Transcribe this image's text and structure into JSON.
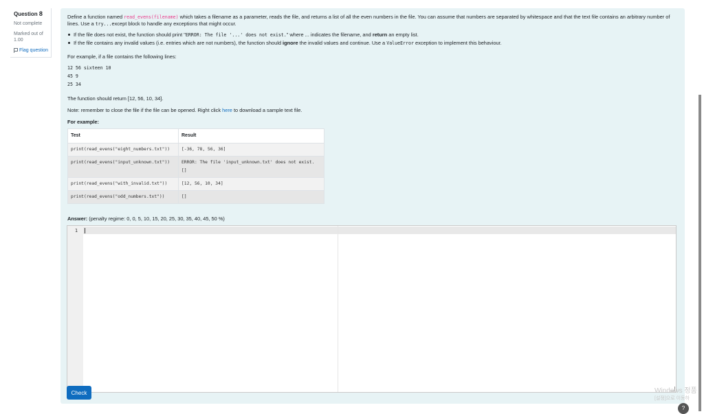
{
  "question": {
    "label": "Question",
    "number": "8",
    "status": "Not complete",
    "marked_out_of": "Marked out of",
    "mark": "1.00",
    "flag_label": "Flag question"
  },
  "text": {
    "p1_a": "Define a function named ",
    "p1_fn": "read_evens(filename)",
    "p1_b": " which takes a filename as a parameter, reads the file, and returns a list of all the even numbers in the file. You can assume that numbers are separated by whitespace and that the text file contains an arbitrary number of lines. Use a ",
    "p1_code": "try...",
    "p1_c": "except block to handle any exceptions that might occur.",
    "b1_a": "If the file does not exist, the function should print \"",
    "b1_code": "ERROR: The file '...' does not exist.",
    "b1_b": "\" where ... indicates the filename, and ",
    "b1_bold": "return",
    "b1_c": " an empty list.",
    "b2_a": "If the file contains any invalid values (i.e. entries which are not numbers), the function should ",
    "b2_bold": "ignore",
    "b2_b": " the invalid values and continue. Use a ",
    "b2_code": "ValueError",
    "b2_c": " exception to implement this behaviour.",
    "example_intro": "For example, if a file contains the following lines:",
    "file_lines": [
      "12 56 sixteen 10",
      "45 9",
      "25 34"
    ],
    "returns": "The function should return [12, 56, 10, 34].",
    "note_a": "Note: remember to close the file if the file can be opened. Right click ",
    "note_link": "here",
    "note_b": " to download a sample text file.",
    "for_example": "For example:"
  },
  "table": {
    "headers": [
      "Test",
      "Result"
    ],
    "rows": [
      {
        "test": "print(read_evens(\"eight_numbers.txt\"))",
        "result": "[-36, 78, 56, 36]",
        "result2": ""
      },
      {
        "test": "print(read_evens(\"input_unknown.txt\"))",
        "result": "ERROR: The file 'input_unknown.txt' does not exist.",
        "result2": "[]"
      },
      {
        "test": "print(read_evens(\"with_invalid.txt\"))",
        "result": "[12, 56, 10, 34]",
        "result2": ""
      },
      {
        "test": "print(read_evens(\"odd_numbers.txt\"))",
        "result": "[]",
        "result2": ""
      }
    ]
  },
  "answer": {
    "label": "Answer:",
    "penalty": "(penalty regime: 0, 0, 5, 10, 15, 20, 25, 30, 35, 40, 45, 50 %)",
    "line_number": "1"
  },
  "check_label": "Check",
  "watermark": {
    "line1": "Windows 정품",
    "line2": "[설정]으로 이동하"
  },
  "help_label": "?"
}
